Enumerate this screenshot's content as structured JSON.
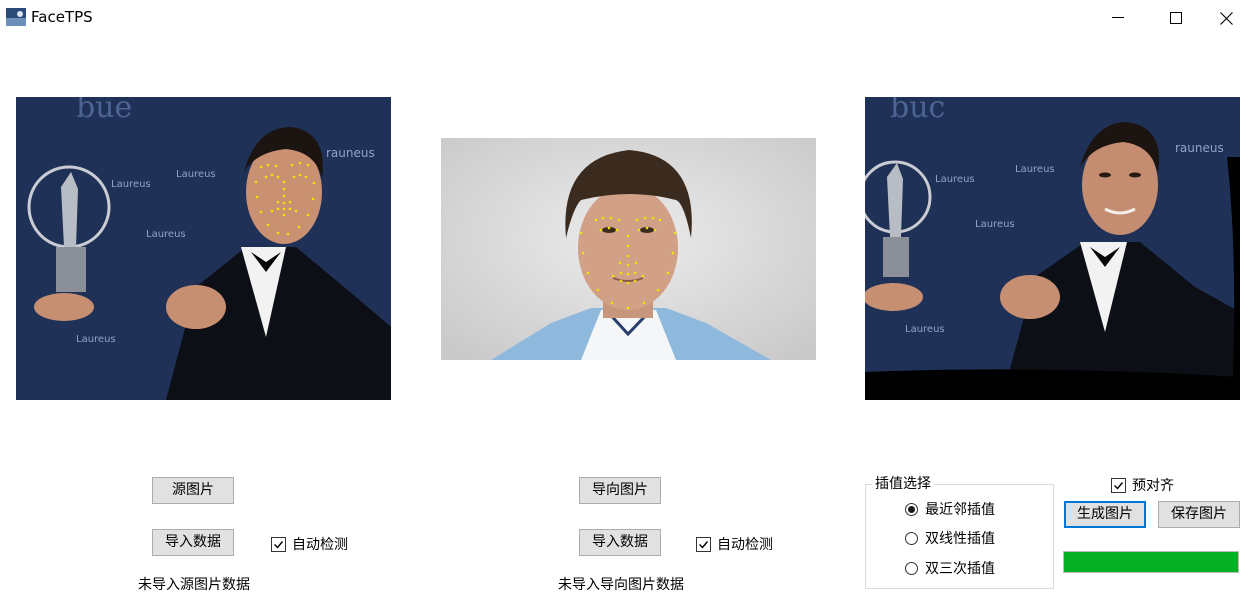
{
  "window": {
    "title": "FaceTPS",
    "minimize_glyph": "—",
    "maximize_glyph": "☐",
    "close_glyph": "✕"
  },
  "images": {
    "source": {
      "icon": "source-photo",
      "backdrop_text": [
        "Laureus",
        "Laureus",
        "Laureus",
        "Laureus"
      ]
    },
    "guide": {
      "icon": "guide-photo"
    },
    "result": {
      "icon": "result-photo",
      "backdrop_text": [
        "Laureus",
        "Laureus",
        "Laureus",
        "Laureus"
      ]
    }
  },
  "source_controls": {
    "load_image_label": "源图片",
    "import_data_label": "导入数据",
    "auto_detect_label": "自动检测",
    "auto_detect_checked": true,
    "status": "未导入源图片数据"
  },
  "guide_controls": {
    "load_image_label": "导向图片",
    "import_data_label": "导入数据",
    "auto_detect_label": "自动检测",
    "auto_detect_checked": true,
    "status": "未导入导向图片数据"
  },
  "interpolation": {
    "group_label": "插值选择",
    "options": [
      "最近邻插值",
      "双线性插值",
      "双三次插值"
    ],
    "selected_index": 0
  },
  "output_controls": {
    "pre_align_label": "预对齐",
    "pre_align_checked": true,
    "generate_label": "生成图片",
    "save_label": "保存图片",
    "progress_fraction": 1.0,
    "progress_color": "#06b025"
  }
}
